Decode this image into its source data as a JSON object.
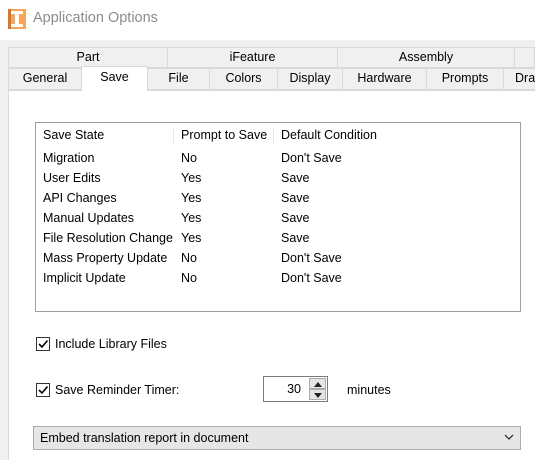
{
  "window": {
    "title": "Application Options"
  },
  "tabs_row1": [
    "Part",
    "iFeature",
    "Assembly"
  ],
  "tabs_row2": [
    "General",
    "Save",
    "File",
    "Colors",
    "Display",
    "Hardware",
    "Prompts",
    "Dra"
  ],
  "active_tab": "Save",
  "save_list": {
    "headers": {
      "state": "Save State",
      "prompt": "Prompt to Save",
      "default": "Default Condition"
    },
    "rows": [
      {
        "state": "Migration",
        "prompt": "No",
        "default": "Don't Save"
      },
      {
        "state": "User Edits",
        "prompt": "Yes",
        "default": "Save"
      },
      {
        "state": "API Changes",
        "prompt": "Yes",
        "default": "Save"
      },
      {
        "state": "Manual Updates",
        "prompt": "Yes",
        "default": "Save"
      },
      {
        "state": "File Resolution Change",
        "prompt": "Yes",
        "default": "Save"
      },
      {
        "state": "Mass Property Update",
        "prompt": "No",
        "default": "Don't Save"
      },
      {
        "state": "Implicit Update",
        "prompt": "No",
        "default": "Don't Save"
      }
    ]
  },
  "include_library": {
    "label": "Include Library Files",
    "checked": true
  },
  "reminder": {
    "label": "Save Reminder Timer:",
    "checked": true,
    "value": "30",
    "unit": "minutes"
  },
  "translation": {
    "selected": "Embed translation report in document"
  }
}
